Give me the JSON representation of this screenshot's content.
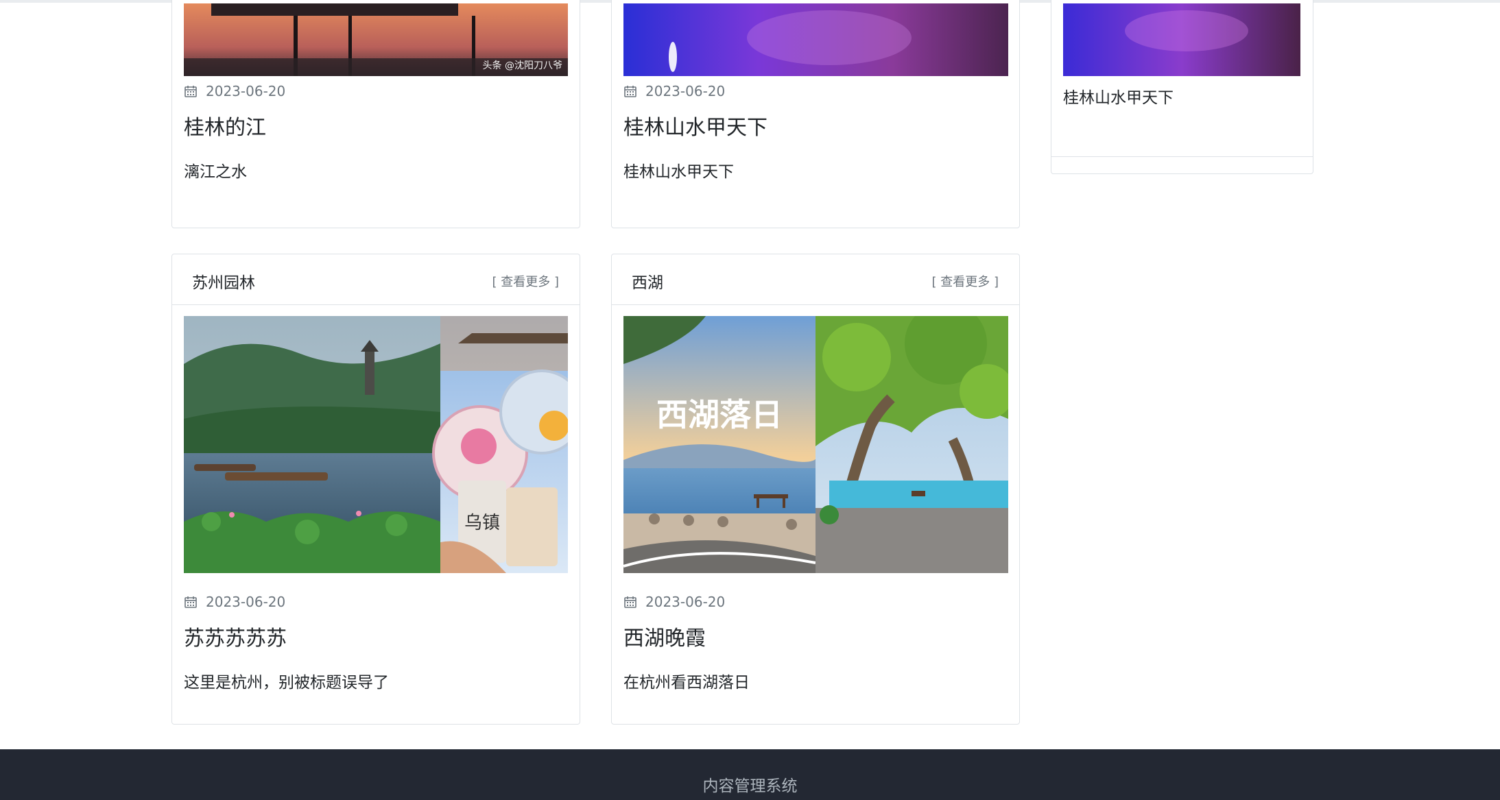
{
  "top_cards": [
    {
      "date": "2023-06-20",
      "title": "桂林的江",
      "desc": "漓江之水",
      "watermark": "头条 @沈阳刀八爷"
    },
    {
      "date": "2023-06-20",
      "title": "桂林山水甲天下",
      "desc": "桂林山水甲天下"
    }
  ],
  "side_card": {
    "desc": "桂林山水甲天下"
  },
  "sections": [
    {
      "title": "苏州园林",
      "more": "[ 查看更多 ]",
      "date": "2023-06-20",
      "post_title": "苏苏苏苏苏",
      "desc": "这里是杭州，别被标题误导了",
      "sign": "乌镇"
    },
    {
      "title": "西湖",
      "more": "[ 查看更多 ]",
      "date": "2023-06-20",
      "post_title": "西湖晚霞",
      "desc": "在杭州看西湖落日",
      "overlay": "西湖落日"
    }
  ],
  "footer": {
    "text": "内容管理系统"
  },
  "colors": {
    "footer_bg": "#232833",
    "border": "#dee2e6",
    "muted": "#6c757d"
  },
  "icons": {
    "date": "calendar-icon"
  }
}
